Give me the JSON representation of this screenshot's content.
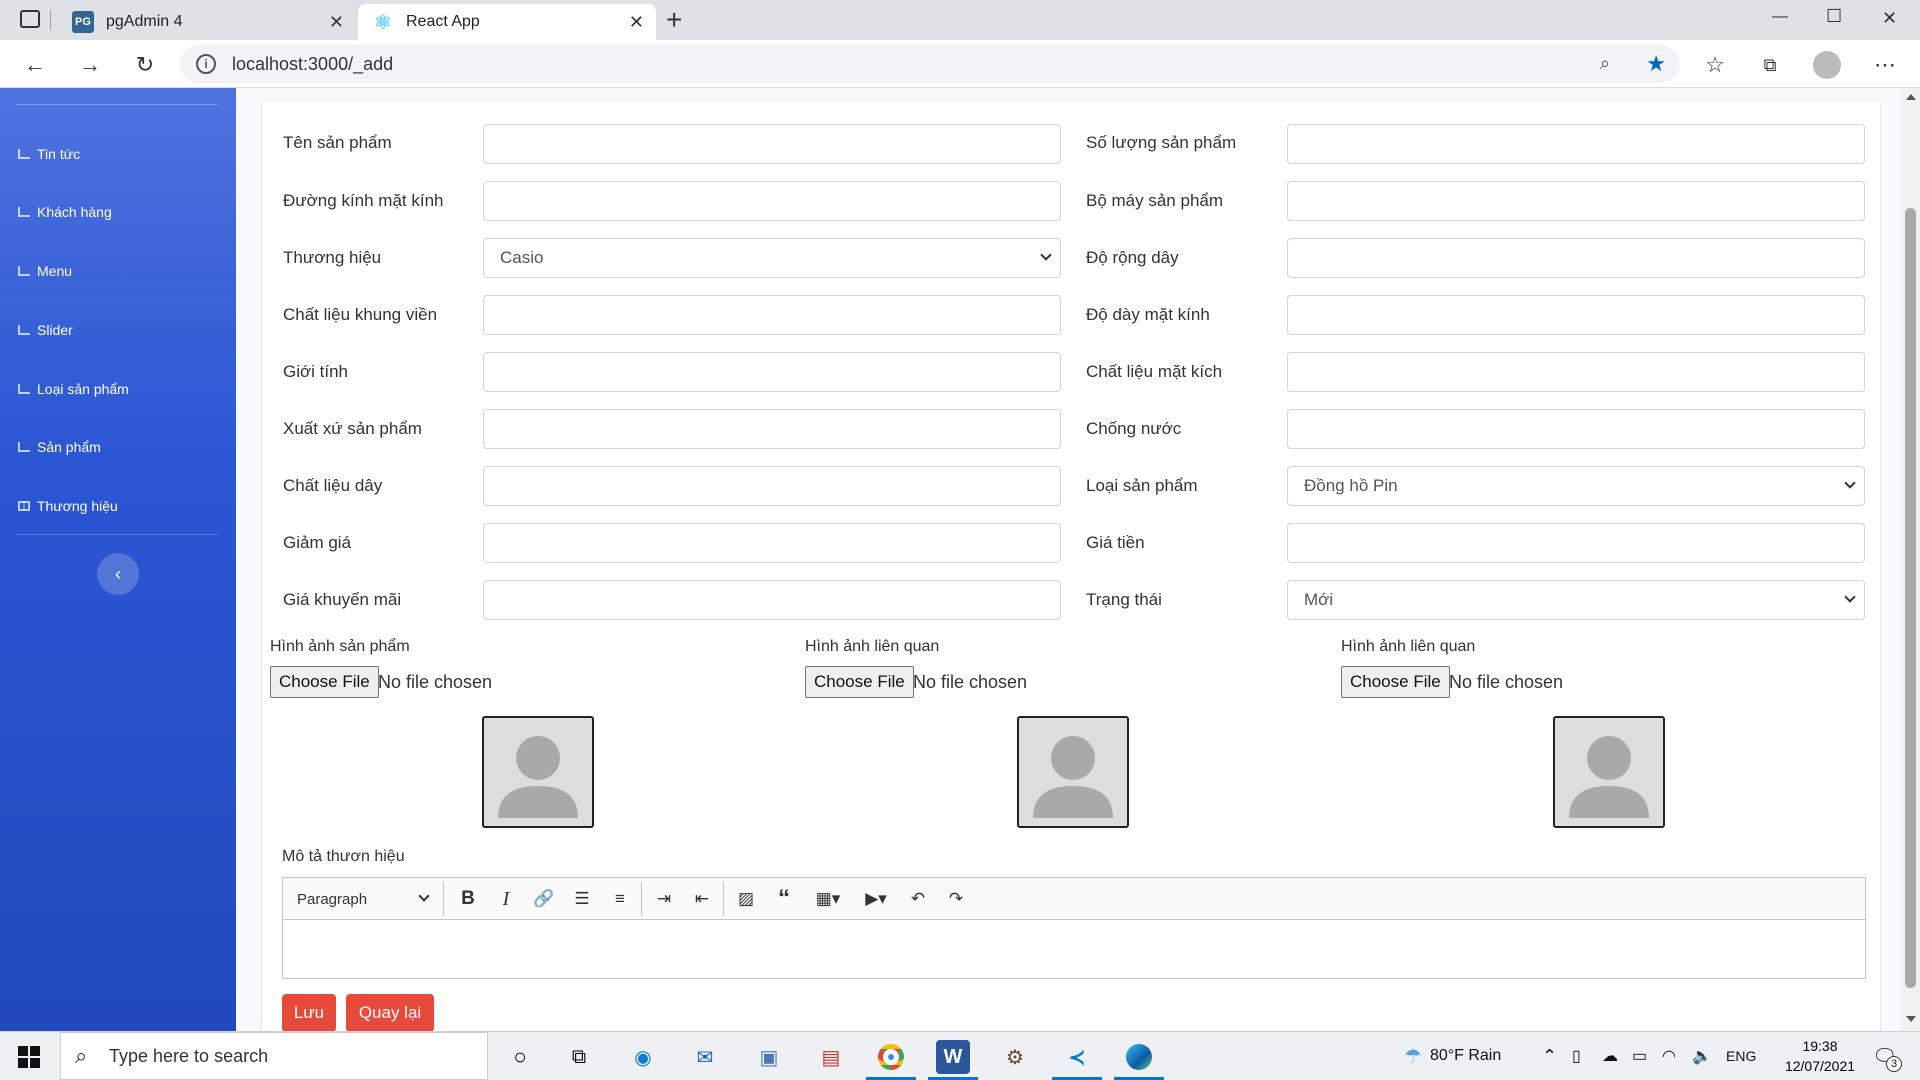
{
  "browser": {
    "tabs": [
      {
        "label": "pgAdmin 4",
        "favicon": "PG",
        "active": false
      },
      {
        "label": "React App",
        "favicon": "react-icon",
        "active": true
      }
    ],
    "new_tab": "+",
    "url": "localhost:3000/_add",
    "window_controls": {
      "minimize": "—",
      "maximize": "☐",
      "close": "✕"
    }
  },
  "sidebar": {
    "items": [
      {
        "label": "Tin tức",
        "icon": "chart-icon"
      },
      {
        "label": "Khách hàng",
        "icon": "chart-icon"
      },
      {
        "label": "Menu",
        "icon": "chart-icon"
      },
      {
        "label": "Slider",
        "icon": "chart-icon"
      },
      {
        "label": "Loại sản phẩm",
        "icon": "chart-icon"
      },
      {
        "label": "Sản phẩm",
        "icon": "chart-icon"
      },
      {
        "label": "Thương hiệu",
        "icon": "table-icon"
      }
    ],
    "toggle": "‹"
  },
  "form": {
    "left": [
      {
        "label": "Tên sản phẩm",
        "value": ""
      },
      {
        "label": "Đường kính mặt kính",
        "value": ""
      },
      {
        "label": "Thương hiệu",
        "value": "Casio",
        "select": true
      },
      {
        "label": "Chất liệu khung viền",
        "value": ""
      },
      {
        "label": "Giới tính",
        "value": ""
      },
      {
        "label": "Xuất xứ sản phẩm",
        "value": ""
      },
      {
        "label": "Chất liệu dây",
        "value": ""
      },
      {
        "label": "Giảm giá",
        "value": ""
      },
      {
        "label": "Giá khuyến mãi",
        "value": ""
      }
    ],
    "right": [
      {
        "label": "Số lượng sản phẩm",
        "value": ""
      },
      {
        "label": "Bộ máy sản phẩm",
        "value": ""
      },
      {
        "label": "Độ rộng dây",
        "value": ""
      },
      {
        "label": "Độ dày mặt kính",
        "value": ""
      },
      {
        "label": "Chất liệu mặt kích",
        "value": ""
      },
      {
        "label": "Chống nước",
        "value": ""
      },
      {
        "label": "Loại sản phẩm",
        "value": "Đồng hồ Pin",
        "select": true
      },
      {
        "label": "Giá tiền",
        "value": ""
      },
      {
        "label": "Trạng thái",
        "value": "Mới",
        "select": true
      }
    ],
    "images": [
      {
        "label": "Hình ảnh sản phẩm",
        "button": "Choose File",
        "status": "No file chosen"
      },
      {
        "label": "Hình ảnh liên quan",
        "button": "Choose File",
        "status": "No file chosen"
      },
      {
        "label": "Hình ảnh liên quan",
        "button": "Choose File",
        "status": "No file chosen"
      }
    ],
    "description_label": "Mô tả thươn hiệu",
    "editor": {
      "block_format": "Paragraph"
    },
    "save_label": "Lưu",
    "back_label": "Quay lại"
  },
  "taskbar": {
    "search_placeholder": "Type here to search",
    "weather": "80°F  Rain",
    "language": "ENG",
    "time": "19:38",
    "date": "12/07/2021",
    "notifications": "3"
  },
  "colors": {
    "sidebar": "#4e73df",
    "danger": "#e74a3b",
    "accent": "#0078d4"
  }
}
